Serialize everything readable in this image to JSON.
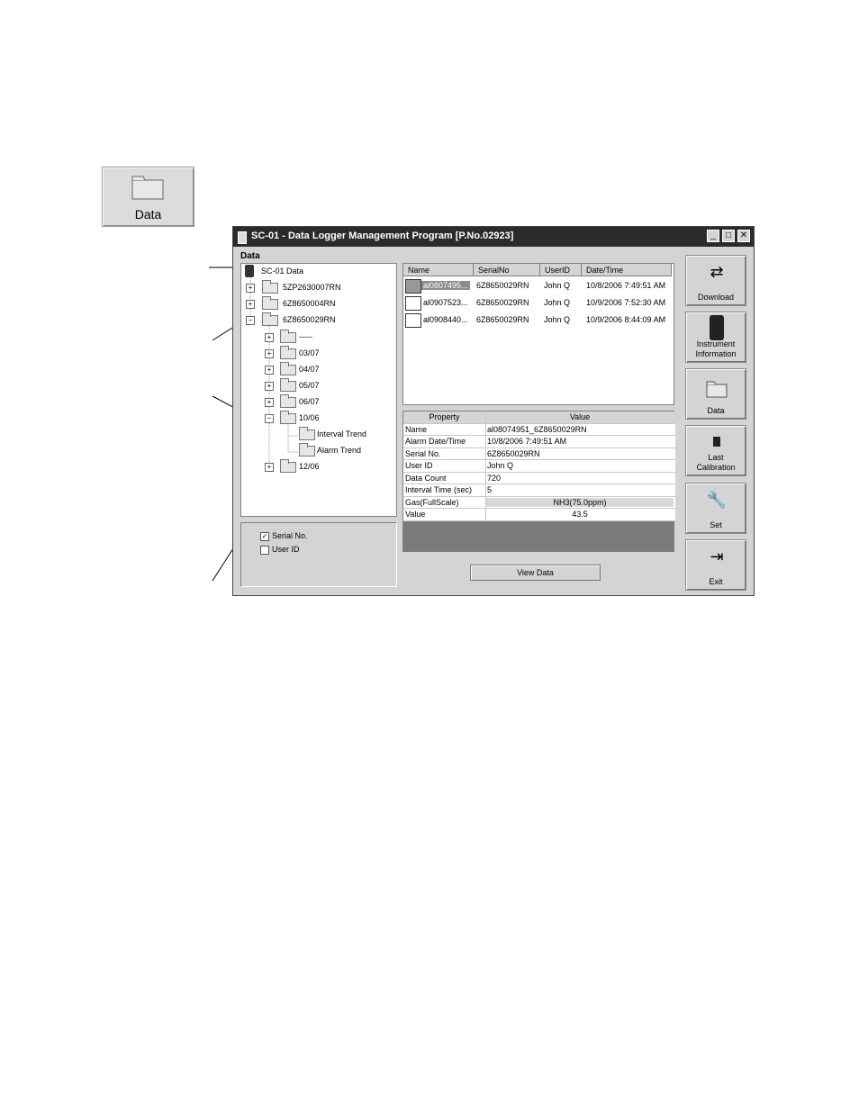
{
  "big_button": {
    "label": "Data",
    "icon": "folder-icon"
  },
  "window": {
    "title": "SC-01 - Data Logger Management Program [P.No.02923]",
    "controls": [
      "minimize",
      "maximize",
      "close"
    ]
  },
  "data_group": {
    "label": "Data"
  },
  "tree": {
    "root": "SC-01 Data",
    "instruments": [
      "5ZP2630007RN",
      "6Z8650004RN",
      "6Z8650029RN"
    ],
    "months": [
      "-----",
      "03/07",
      "04/07",
      "05/07",
      "06/07",
      "10/06",
      "12/06"
    ],
    "logs": [
      "Interval Trend",
      "Alarm Trend"
    ]
  },
  "options": {
    "serial_no": "Serial No.",
    "user_id": "User ID"
  },
  "file_list": {
    "columns": [
      "Name",
      "SerialNo",
      "UserID",
      "Date/Time"
    ],
    "rows": [
      {
        "name": "al0807495...",
        "serial": "6Z8650029RN",
        "user": "John Q",
        "datetime": "10/8/2006 7:49:51 AM"
      },
      {
        "name": "al0907523...",
        "serial": "6Z8650029RN",
        "user": "John Q",
        "datetime": "10/9/2006 7:52:30 AM"
      },
      {
        "name": "al0908440...",
        "serial": "6Z8650029RN",
        "user": "John Q",
        "datetime": "10/9/2006 8:44:09 AM"
      }
    ]
  },
  "properties": {
    "columns": [
      "Property",
      "Value"
    ],
    "rows": [
      {
        "k": "Name",
        "v": "al08074951_6Z8650029RN"
      },
      {
        "k": "Alarm Date/Time",
        "v": "10/8/2006 7:49:51 AM"
      },
      {
        "k": "Serial No.",
        "v": "6Z8650029RN"
      },
      {
        "k": "User ID",
        "v": "John Q"
      },
      {
        "k": "Data Count",
        "v": "720"
      },
      {
        "k": "Interval Time (sec)",
        "v": "5"
      },
      {
        "k": "Gas(FullScale)",
        "v": "NH3(75.0ppm)"
      },
      {
        "k": "Value",
        "v": "43.5"
      }
    ]
  },
  "view_button": "View Data",
  "side_buttons": {
    "download": "Download",
    "instrument_info_1": "Instrument",
    "instrument_info_2": "Information",
    "data": "Data",
    "last_cal_1": "Last",
    "last_cal_2": "Calibration",
    "set": "Set",
    "exit": "Exit"
  }
}
